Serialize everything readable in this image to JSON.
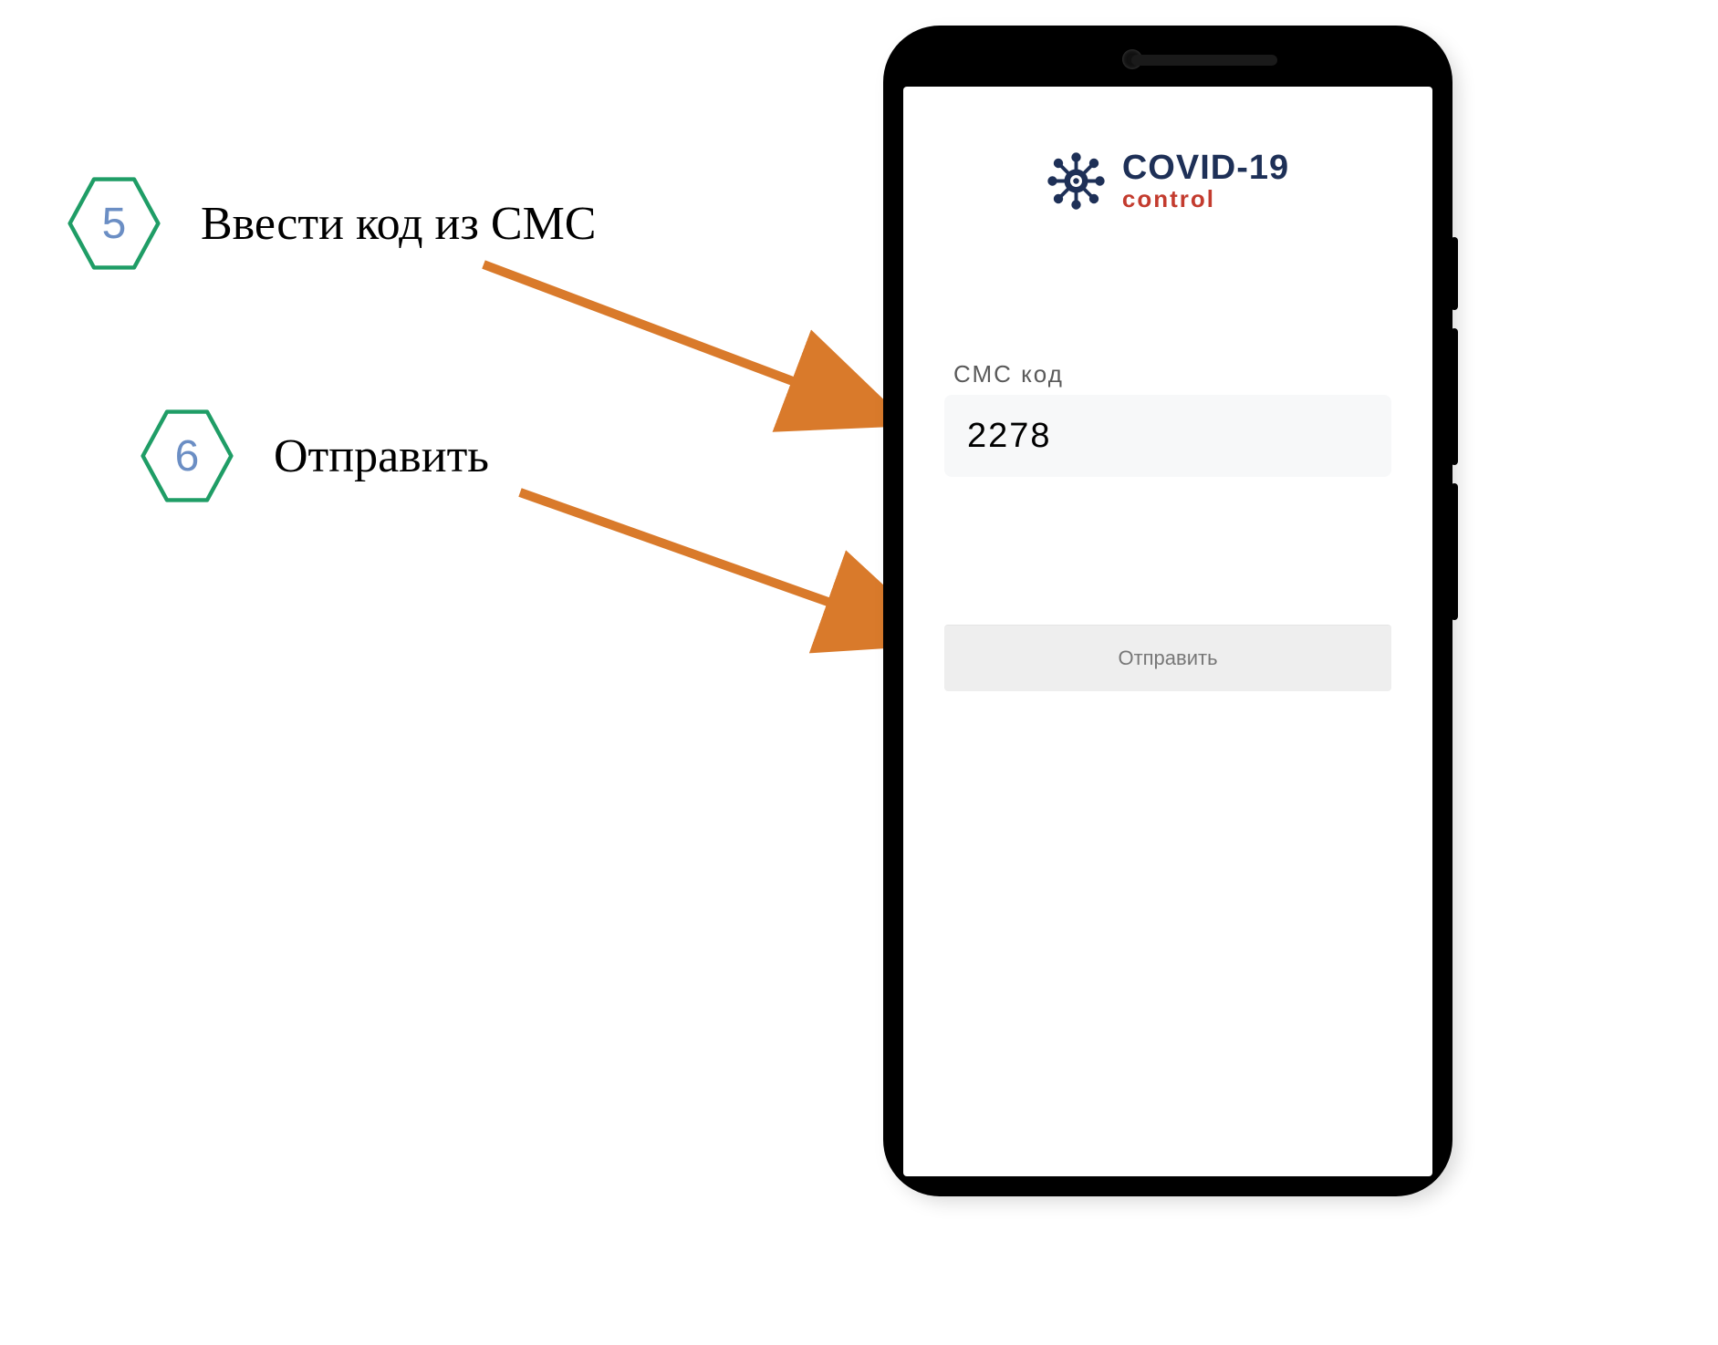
{
  "steps": {
    "s5": {
      "num": "5",
      "label": "Ввести код из СМС"
    },
    "s6": {
      "num": "6",
      "label": "Отправить"
    }
  },
  "app": {
    "logo_title": "COVID-19",
    "logo_sub": "control",
    "sms_label": "СМС  код",
    "sms_value": "2278",
    "send_label": "Отправить"
  },
  "colors": {
    "hex_stroke": "#1f9d66",
    "step_num": "#6b8ec4",
    "arrow": "#d97a2b",
    "logo_primary": "#1e3057",
    "logo_accent": "#c33b2e"
  }
}
